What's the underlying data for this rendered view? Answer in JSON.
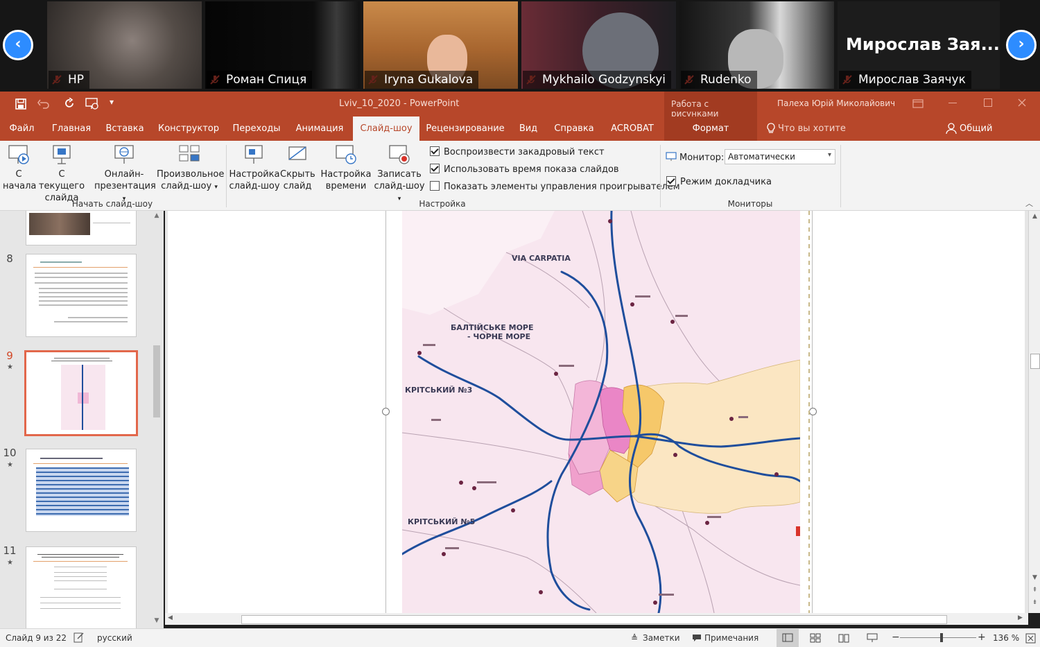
{
  "call": {
    "participants": [
      {
        "name": "HP"
      },
      {
        "name": "Роман Спиця"
      },
      {
        "name": "Iryna Gukalova"
      },
      {
        "name": "Mykhailo Godzynskyi"
      },
      {
        "name": "Rudenko"
      },
      {
        "name": "Мирослав Заячук",
        "banner": "Мирослав  Зая..."
      }
    ]
  },
  "titlebar": {
    "doc_title": "Lviv_10_2020  -  PowerPoint",
    "context_tab": "Работа с рисунками",
    "user": "Палеха Юрій Миколайович"
  },
  "tabs": [
    "Файл",
    "Главная",
    "Вставка",
    "Конструктор",
    "Переходы",
    "Анимация",
    "Слайд-шоу",
    "Рецензирование",
    "Вид",
    "Справка",
    "ACROBAT",
    "Формат"
  ],
  "tell_me": "Что вы хотите сделать?",
  "share": "Общий доступ",
  "ribbon": {
    "start_group": {
      "label": "Начать слайд-шоу",
      "from_start_1": "С",
      "from_start_2": "начала",
      "from_current_1": "С текущего",
      "from_current_2": "слайда",
      "online_1": "Онлайн-",
      "online_2": "презентация",
      "custom_1": "Произвольное",
      "custom_2": "слайд-шоу"
    },
    "setup_group": {
      "label": "Настройка",
      "setup_1": "Настройка",
      "setup_2": "слайд-шоу",
      "hide_1": "Скрыть",
      "hide_2": "слайд",
      "rehearse_1": "Настройка",
      "rehearse_2": "времени",
      "record_1": "Записать",
      "record_2": "слайд-шоу",
      "cb_narration": "Воспроизвести закадровый текст",
      "cb_timings": "Использовать время показа слайдов",
      "cb_controls": "Показать элементы управления проигрывателем"
    },
    "monitors_group": {
      "label": "Мониторы",
      "monitor_label": "Монитор:",
      "monitor_value": "Автоматически",
      "presenter_view": "Режим докладчика"
    }
  },
  "thumbnails": [
    {
      "num": "8"
    },
    {
      "num": "9",
      "star": "★"
    },
    {
      "num": "10",
      "star": "★"
    },
    {
      "num": "11",
      "star": "★"
    }
  ],
  "map": {
    "labels": {
      "via_carpatia": "VIA CARPATIA",
      "baltic_1": "БАЛТІЙСЬКЕ МОРЕ",
      "baltic_2": "- ЧОРНЕ МОРЕ",
      "corridor3": "КРІТСЬКИЙ №3",
      "corridor5": "КРІТСЬКИЙ №5"
    }
  },
  "status": {
    "slide_info": "Слайд 9 из 22",
    "language": "русский",
    "notes": "Заметки",
    "comments": "Примечания",
    "zoom": "136 %"
  },
  "colors": {
    "accent": "#b7472a",
    "zoom_button": "#2d8cff",
    "map_route": "#1f4e9c",
    "map_bg": "#f8e6ef"
  }
}
